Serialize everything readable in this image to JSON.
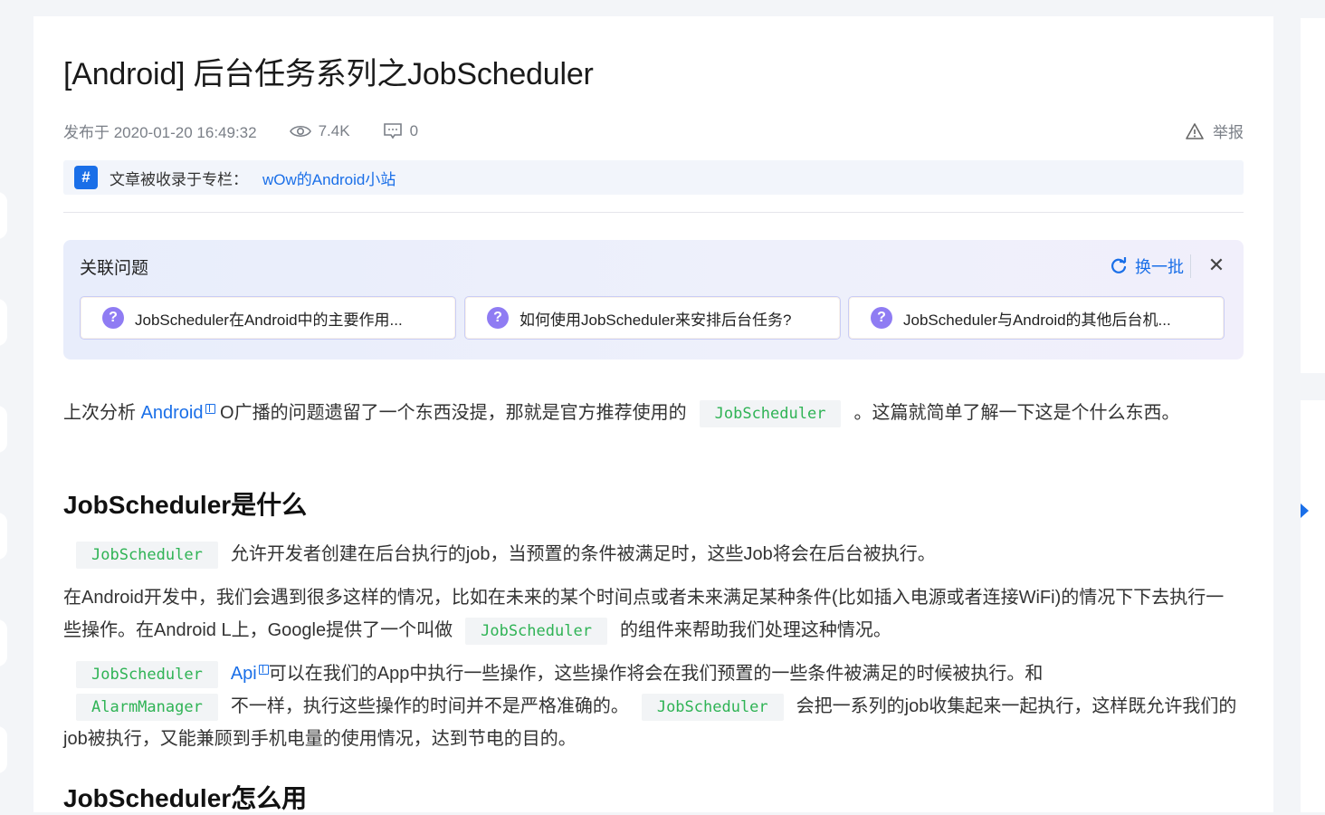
{
  "article": {
    "title": "[Android] 后台任务系列之JobScheduler",
    "published": "发布于 2020-01-20 16:49:32",
    "views": "7.4K",
    "comments": "0",
    "report": "举报"
  },
  "column": {
    "label": "文章被收录于专栏：",
    "name": "wOw的Android小站"
  },
  "related": {
    "title": "关联问题",
    "refresh": "换一批",
    "questions": [
      "JobScheduler在Android中的主要作用...",
      "如何使用JobScheduler来安排后台任务?",
      "JobScheduler与Android的其他后台机..."
    ]
  },
  "content": {
    "p1_pre": "上次分析 ",
    "p1_link": "Android",
    "p1_mid": " O广播的问题遗留了一个东西没提，那就是官方推荐使用的",
    "p1_code": "JobScheduler",
    "p1_post": "。这篇就简单了解一下这是个什么东西。",
    "h2_1": "JobScheduler是什么",
    "p2_code": "JobScheduler",
    "p2_text": "允许开发者创建在后台执行的job，当预置的条件被满足时，这些Job将会在后台被执行。",
    "p3_text": "在Android开发中，我们会遇到很多这样的情况，比如在未来的某个时间点或者未来满足某种条件(比如插入电源或者连接WiFi)的情况下下去执行一些操作。在Android L上，Google提供了一个叫做",
    "p3_code": "JobScheduler",
    "p3_post": "的组件来帮助我们处理这种情况。",
    "p4_code1": "JobScheduler",
    "p4_link": "Api",
    "p4_text1": "可以在我们的App中执行一些操作，这些操作将会在我们预置的一些条件被满足的时候被执行。和",
    "p4_code2": "AlarmManager",
    "p4_text2": "不一样，执行这些操作的时间并不是严格准确的。",
    "p4_code3": "JobScheduler",
    "p4_text3": "会把一系列的job收集起来一起执行，这样既允许我们的job被执行，又能兼顾到手机电量的使用情况，达到节电的目的。",
    "h2_2": "JobScheduler怎么用"
  }
}
